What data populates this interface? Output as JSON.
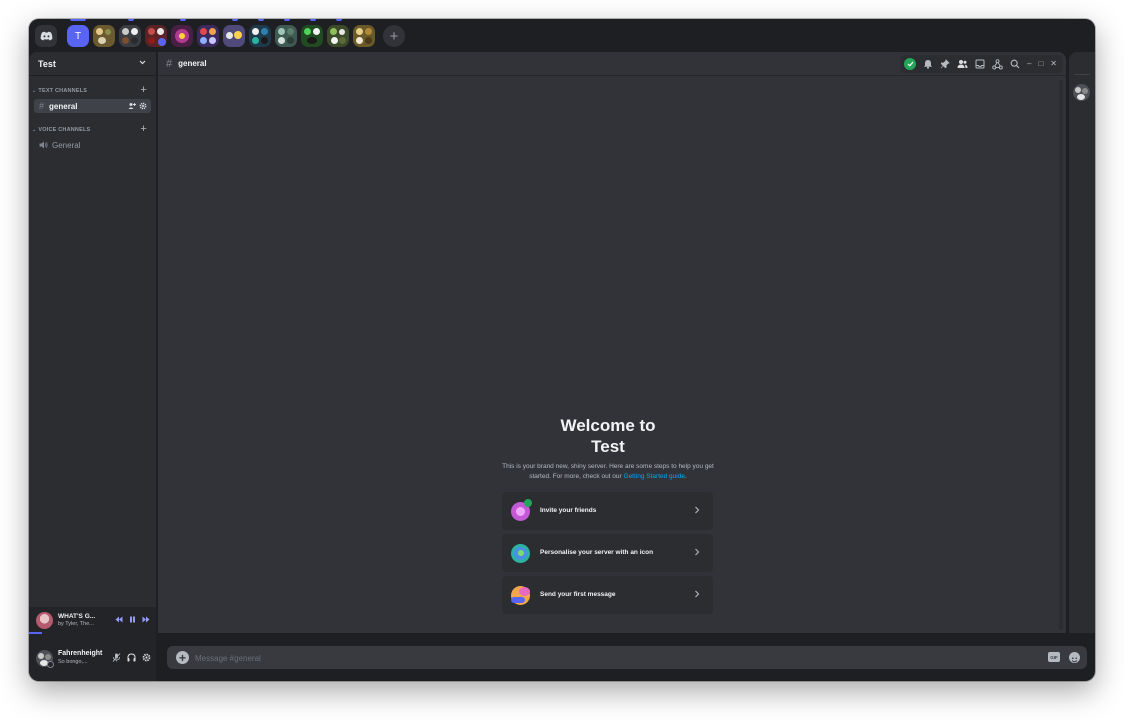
{
  "server": {
    "name": "Test",
    "initial": "T"
  },
  "sidebar": {
    "categories": [
      {
        "label": "TEXT CHANNELS"
      },
      {
        "label": "VOICE CHANNELS"
      }
    ],
    "text_channels": [
      {
        "name": "general",
        "icon": "hash-icon"
      }
    ],
    "voice_channels": [
      {
        "name": "General",
        "icon": "speaker-icon"
      }
    ]
  },
  "now_playing": {
    "title": "WHAT'S G...",
    "artist": "by Tyler, The...",
    "progress": 0.1
  },
  "user": {
    "name": "Fahrenheight",
    "status": "So bongo,..."
  },
  "channel_header": {
    "name": "general"
  },
  "welcome": {
    "title_line1": "Welcome to",
    "title_line2": "Test",
    "body": "This is your brand new, shiny server. Here are some steps to help you get started. For more, check out our ",
    "link": "Getting Started guide",
    "period": "."
  },
  "actions": [
    {
      "label": "Invite your friends",
      "icon": "invite-friends-icon"
    },
    {
      "label": "Personalise your server with an icon",
      "icon": "personalise-icon"
    },
    {
      "label": "Send your first message",
      "icon": "first-message-icon"
    }
  ],
  "composer": {
    "placeholder": "Message #general",
    "gif_label": "GIF"
  },
  "colors": {
    "accent": "#5865f2",
    "online": "#23a55a",
    "link": "#00a8fc",
    "background": "#313338"
  }
}
